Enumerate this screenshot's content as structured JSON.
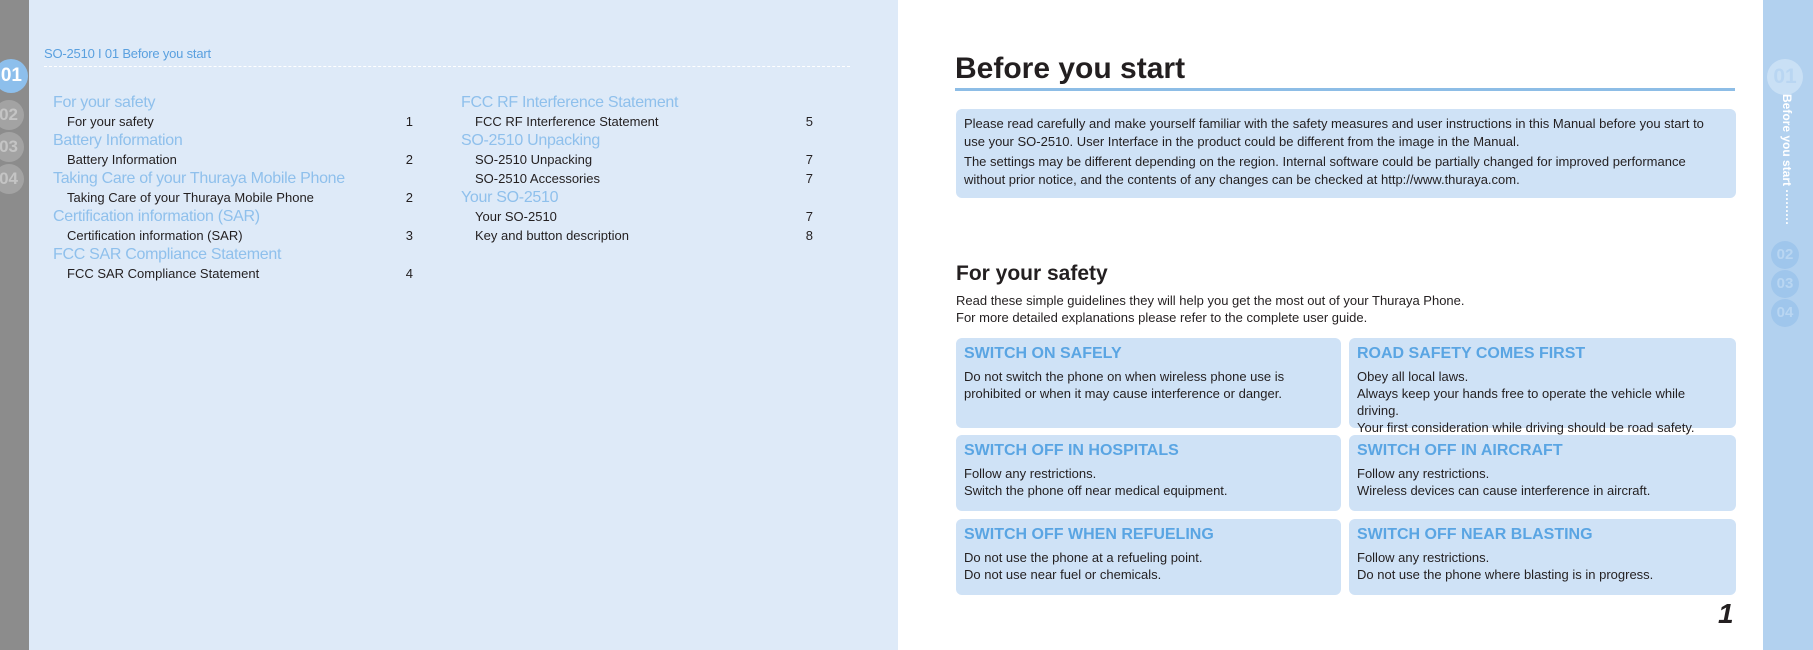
{
  "left_page": {
    "running_header": "SO-2510 I 01 Before you start",
    "chapter_tabs": [
      "01",
      "02",
      "03",
      "04"
    ],
    "toc_columns": [
      [
        {
          "heading": "For your safety",
          "items": [
            {
              "label": "For your safety",
              "page": "1"
            }
          ]
        },
        {
          "heading": "Battery Information",
          "items": [
            {
              "label": "Battery Information",
              "page": "2"
            }
          ]
        },
        {
          "heading": "Taking Care of your Thuraya Mobile Phone",
          "items": [
            {
              "label": "Taking Care of your Thuraya Mobile Phone",
              "page": "2"
            }
          ]
        },
        {
          "heading": "Certification information (SAR)",
          "items": [
            {
              "label": "Certification information (SAR)",
              "page": "3"
            }
          ]
        },
        {
          "heading": "FCC SAR Compliance Statement",
          "items": [
            {
              "label": "FCC SAR Compliance Statement",
              "page": "4"
            }
          ]
        }
      ],
      [
        {
          "heading": "FCC RF Interference Statement",
          "items": [
            {
              "label": "FCC RF Interference Statement",
              "page": "5"
            }
          ]
        },
        {
          "heading": "SO-2510 Unpacking",
          "items": [
            {
              "label": "SO-2510 Unpacking",
              "page": "7"
            },
            {
              "label": "SO-2510 Accessories",
              "page": "7"
            }
          ]
        },
        {
          "heading": "Your SO-2510",
          "items": [
            {
              "label": "Your SO-2510",
              "page": "7"
            },
            {
              "label": "Key and button description",
              "page": "8"
            }
          ]
        }
      ]
    ]
  },
  "right_page": {
    "title": "Before you start",
    "intro": [
      "Please read carefully and make yourself familiar with the safety measures and user instructions in this Manual before you start to use your SO-2510. User Interface in the product could be different from the image in the Manual.",
      "The settings may be different depending on the region. Internal software could be partially changed for improved performance without prior notice, and the contents of any changes can be checked at http://www.thuraya.com."
    ],
    "safety_heading": "For your safety",
    "safety_sub": [
      "Read these simple guidelines they will help you get the most out of your Thuraya Phone.",
      "For more detailed explanations please refer to the complete user guide."
    ],
    "cards": [
      {
        "title": "SWITCH ON SAFELY",
        "lines": [
          "Do not switch the phone on when wireless phone use is prohibited or when it may cause interference or danger."
        ]
      },
      {
        "title": "ROAD SAFETY COMES FIRST",
        "lines": [
          "Obey all local laws.",
          "Always keep your hands free to operate the vehicle while driving.",
          "Your first consideration while driving should be road safety."
        ]
      },
      {
        "title": "SWITCH OFF IN HOSPITALS",
        "lines": [
          "Follow any restrictions.",
          "Switch the phone off near medical equipment."
        ]
      },
      {
        "title": "SWITCH OFF IN AIRCRAFT",
        "lines": [
          "Follow any restrictions.",
          "Wireless devices can cause interference in aircraft."
        ]
      },
      {
        "title": "SWITCH OFF WHEN REFUELING",
        "lines": [
          "Do not use the phone at a refueling point.",
          "Do not use near fuel or chemicals."
        ]
      },
      {
        "title": "SWITCH OFF NEAR BLASTING",
        "lines": [
          "Follow any restrictions.",
          "Do not use the phone where blasting is in progress."
        ]
      }
    ],
    "page_number": "1",
    "side_tab": {
      "active": "01",
      "label": "Before you start ·········",
      "others": [
        "02",
        "03",
        "04"
      ]
    }
  },
  "colors": {
    "accent": "#5aa5e3",
    "card_bg": "#cfe2f6",
    "left_bg": "#deeaf8",
    "side_bg": "#b2d1ef"
  }
}
